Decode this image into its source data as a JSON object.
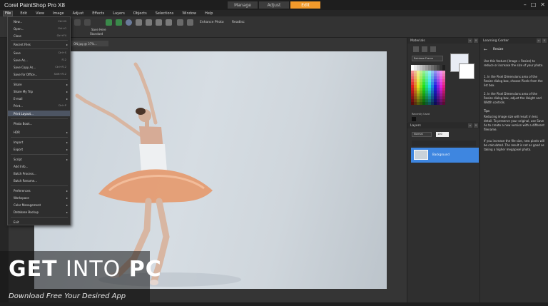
{
  "app": {
    "title": "Corel PaintShop Pro X8",
    "modes": [
      "Manage",
      "Adjust",
      "Edit"
    ],
    "active_mode": "Edit",
    "window_controls": [
      "–",
      "□",
      "✕"
    ]
  },
  "menubar": {
    "items": [
      "File",
      "Edit",
      "View",
      "Image",
      "Adjust",
      "Effects",
      "Layers",
      "Objects",
      "Selections",
      "Window",
      "Help"
    ],
    "open_item": "File"
  },
  "toolbar": {
    "labels": [
      "Save Here",
      "Standard"
    ],
    "enhance_label": "Enhance Photo",
    "rearrange_label": "Readtsc"
  },
  "document": {
    "tab_label": "ON.jpg @ 37%..."
  },
  "file_menu": {
    "items": [
      {
        "label": "New...",
        "shortcut": "Ctrl+N"
      },
      {
        "label": "Open...",
        "shortcut": "Ctrl+O"
      },
      {
        "label": "Close",
        "shortcut": "Ctrl+F4"
      },
      {
        "label": "Recent Files",
        "shortcut": "",
        "submenu": true
      },
      {
        "label": "Save",
        "shortcut": "Ctrl+S"
      },
      {
        "label": "Save As...",
        "shortcut": "F12"
      },
      {
        "label": "Save Copy As...",
        "shortcut": "Ctrl+F12"
      },
      {
        "label": "Save for Office...",
        "shortcut": "Shift+F12"
      },
      {
        "label": "Share",
        "shortcut": "",
        "submenu": true
      },
      {
        "label": "Share My Trip",
        "shortcut": "",
        "submenu": true
      },
      {
        "label": "E-mail",
        "shortcut": "",
        "submenu": true
      },
      {
        "label": "Print...",
        "shortcut": "Ctrl+P"
      },
      {
        "label": "Print Layout...",
        "shortcut": ""
      },
      {
        "label": "Photo Book...",
        "shortcut": ""
      },
      {
        "label": "HDR",
        "shortcut": "",
        "submenu": true
      },
      {
        "label": "Import",
        "shortcut": "",
        "submenu": true
      },
      {
        "label": "Export",
        "shortcut": "",
        "submenu": true
      },
      {
        "label": "Script",
        "shortcut": "",
        "submenu": true
      },
      {
        "label": "Add Info...",
        "shortcut": ""
      },
      {
        "label": "Batch Process...",
        "shortcut": ""
      },
      {
        "label": "Batch Rename...",
        "shortcut": ""
      },
      {
        "label": "Preferences",
        "shortcut": "",
        "submenu": true
      },
      {
        "label": "Workspace",
        "shortcut": "",
        "submenu": true
      },
      {
        "label": "Color Management",
        "shortcut": "",
        "submenu": true
      },
      {
        "label": "Database Backup",
        "shortcut": "",
        "submenu": true
      },
      {
        "label": "Exit",
        "shortcut": ""
      }
    ],
    "highlighted": "Print Layout..."
  },
  "materials": {
    "title": "Materials",
    "frame_label": "Rainbow Frame",
    "recent_label": "Recently Used"
  },
  "layers": {
    "title": "Layers",
    "blend_mode": "Normal",
    "opacity": "100",
    "layer_name": "Background"
  },
  "learning_center": {
    "title": "Learning Center",
    "topic": "Resize",
    "intro": "Use this feature (Image » Resize) to reduce or increase the size of your photo.",
    "steps": [
      "1. In the Pixel Dimensions area of the Resize dialog box, choose Pixels from the list box.",
      "2. In the Pixel Dimensions area of the Resize dialog box, adjust the Height and Width controls."
    ],
    "tips_heading": "Tips",
    "tips": [
      "Reducing image size will result in less detail. To preserve your original, use Save As to create a new version with a different filename.",
      "If you increase the file size, new pixels will be calculated. The result is not as good as taking a higher megapixel photo."
    ]
  },
  "watermark": {
    "title_get": "GET ",
    "title_into": "INTO",
    "title_pc": " PC",
    "subtitle": "Download Free Your Desired App"
  },
  "colors": {
    "accent": "#f39a2b",
    "layer_selected": "#3e86e0"
  }
}
